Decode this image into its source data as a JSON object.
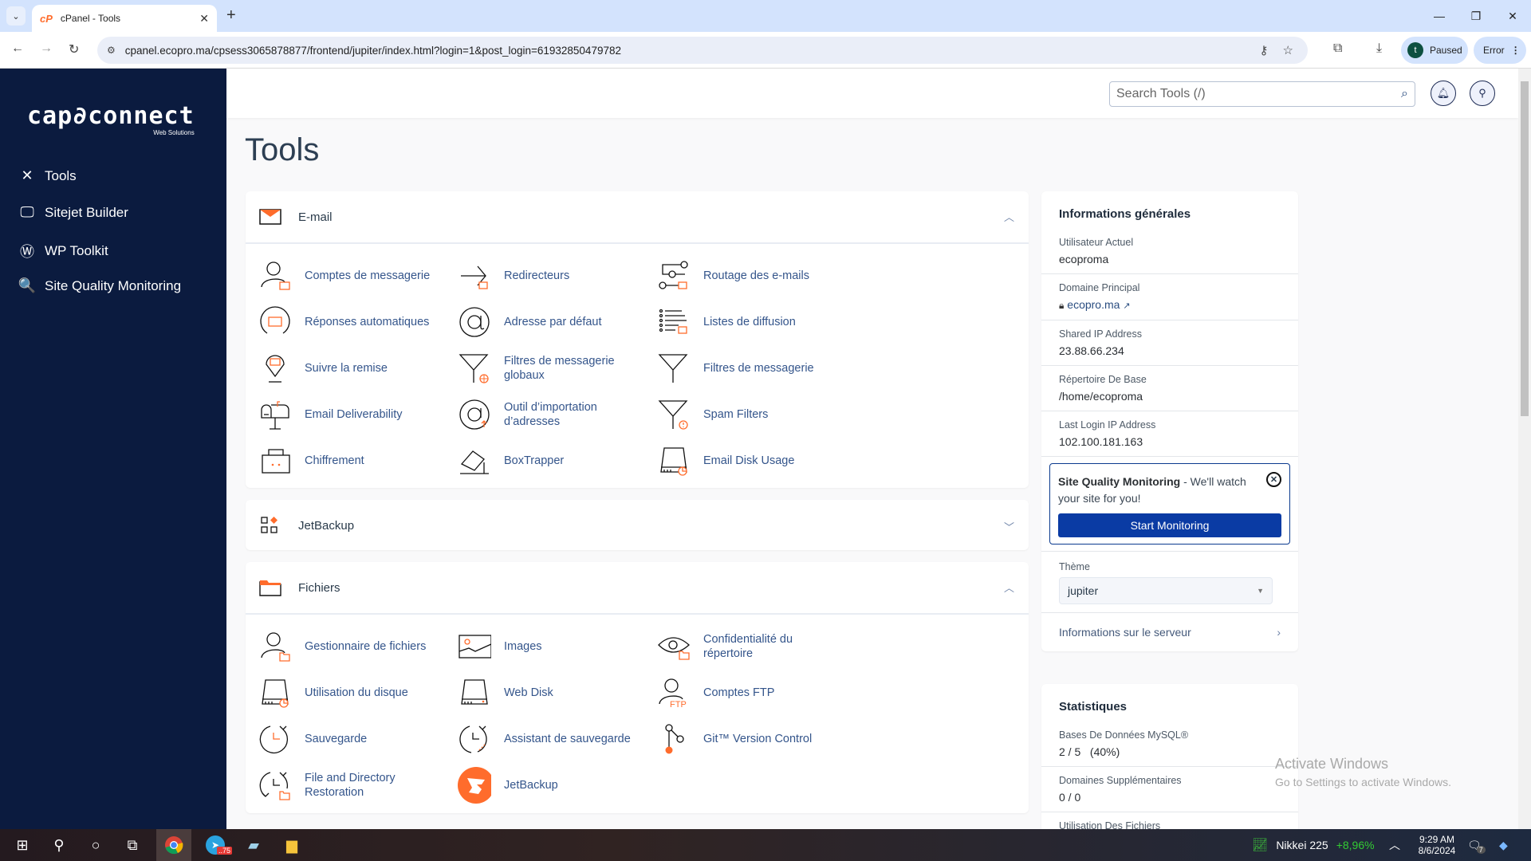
{
  "browser": {
    "tab_title": "cPanel - Tools",
    "url": "cpanel.ecopro.ma/cpsess3065878877/frontend/jupiter/index.html?login=1&post_login=61932850479782",
    "profile_initial": "t",
    "profile_status": "Paused",
    "error_label": "Error"
  },
  "sidebar": {
    "logo": "cap∂connect",
    "logo_sub": "Web Solutions",
    "items": [
      {
        "label": "Tools",
        "icon": "tools-icon"
      },
      {
        "label": "Sitejet Builder",
        "icon": "monitor-icon"
      },
      {
        "label": "WP Toolkit",
        "icon": "wordpress-icon"
      },
      {
        "label": "Site Quality Monitoring",
        "icon": "search-check-icon"
      }
    ]
  },
  "topbar": {
    "search_placeholder": "Search Tools (/)"
  },
  "page": {
    "title": "Tools"
  },
  "sections": {
    "email": {
      "title": "E-mail",
      "expanded": true,
      "tools": [
        "Comptes de messagerie",
        "Redirecteurs",
        "Routage des e-mails",
        "Réponses automatiques",
        "Adresse par défaut",
        "Listes de diffusion",
        "Suivre la remise",
        "Filtres de messagerie globaux",
        "Filtres de messagerie",
        "Email Deliverability",
        "Outil d’importation d’adresses",
        "Spam Filters",
        "Chiffrement",
        "BoxTrapper",
        "Email Disk Usage"
      ]
    },
    "jetbackup": {
      "title": "JetBackup",
      "expanded": false
    },
    "files": {
      "title": "Fichiers",
      "expanded": true,
      "tools": [
        "Gestionnaire de fichiers",
        "Images",
        "Confidentialité du répertoire",
        "Utilisation du disque",
        "Web Disk",
        "Comptes FTP",
        "Sauvegarde",
        "Assistant de sauvegarde",
        "Git™ Version Control",
        "File and Directory Restoration",
        "JetBackup"
      ]
    }
  },
  "general_info": {
    "title": "Informations générales",
    "rows": [
      {
        "label": "Utilisateur Actuel",
        "value": "ecoproma"
      },
      {
        "label": "Domaine Principal",
        "value": "ecopro.ma"
      },
      {
        "label": "Shared IP Address",
        "value": "23.88.66.234"
      },
      {
        "label": "Répertoire De Base",
        "value": "/home/ecoproma"
      },
      {
        "label": "Last Login IP Address",
        "value": "102.100.181.163"
      }
    ],
    "sqm_title": "Site Quality Monitoring",
    "sqm_text": " - We'll watch your site for you!",
    "sqm_button": "Start Monitoring",
    "theme_label": "Thème",
    "theme_value": "jupiter",
    "server_info": "Informations sur le serveur"
  },
  "stats": {
    "title": "Statistiques",
    "rows": [
      {
        "label": "Bases De Données MySQL®",
        "value": "2 / 5   (40%)"
      },
      {
        "label": "Domaines Supplémentaires",
        "value": "0 / 0"
      },
      {
        "label": "Utilisation Des Fichiers",
        "value": ""
      }
    ]
  },
  "watermark": {
    "line1": "Activate Windows",
    "line2": "Go to Settings to activate Windows."
  },
  "taskbar": {
    "telegram_badge": "..75",
    "ticker_name": "Nikkei 225",
    "ticker_change": "+8,96%",
    "time": "9:29 AM",
    "date": "8/6/2024",
    "notifications": "7"
  },
  "colors": {
    "sidebar_bg": "#0b1b3f",
    "accent_orange": "#ff6c2c",
    "link_blue": "#34558b",
    "button_blue": "#0a3ba4",
    "ticker_green": "#33cc33"
  }
}
